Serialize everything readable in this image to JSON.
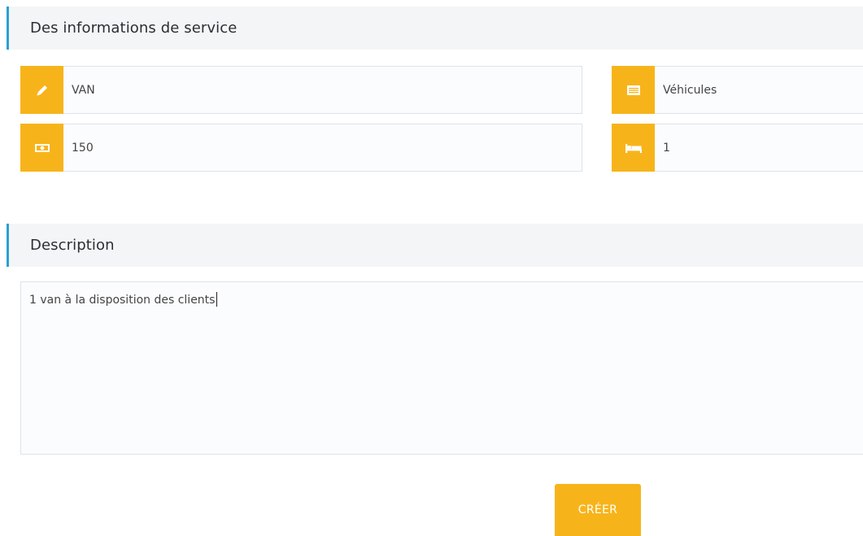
{
  "sections": {
    "service_info": {
      "title": "Des informations de service"
    },
    "description": {
      "title": "Description"
    }
  },
  "fields": {
    "name": {
      "value": "VAN",
      "icon": "pencil-icon"
    },
    "category": {
      "value": "Véhicules",
      "icon": "list-icon"
    },
    "price": {
      "value": "150",
      "icon": "money-icon"
    },
    "capacity": {
      "value": "1",
      "icon": "bed-icon"
    }
  },
  "description": {
    "value": "1 van à la disposition des clients"
  },
  "actions": {
    "create_label": "CRÉER"
  },
  "colors": {
    "accent": "#f7b41a",
    "header_border": "#2aa0d4",
    "header_bg": "#f4f5f7"
  }
}
